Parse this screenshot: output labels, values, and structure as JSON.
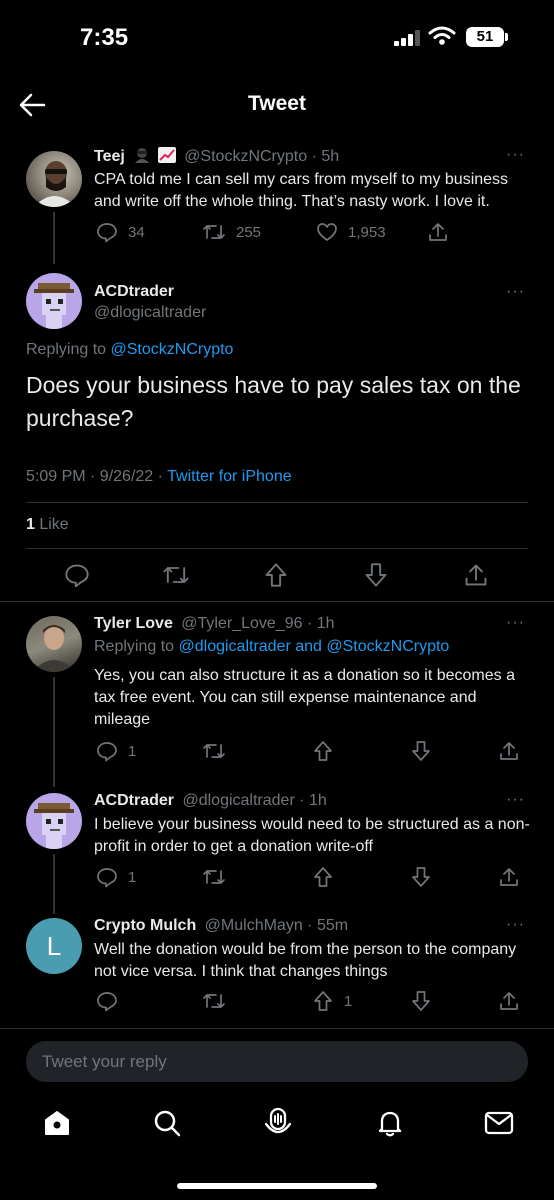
{
  "status": {
    "time": "7:35",
    "battery": "51"
  },
  "header": {
    "title": "Tweet"
  },
  "tweet1": {
    "name": "Teej",
    "handle": "@StockzNCrypto",
    "time": "· 5h",
    "text": "CPA told me I can sell my cars from myself to my business and write off the whole thing. That’s nasty work. I love it.",
    "replies": "34",
    "retweets": "255",
    "likes": "1,953"
  },
  "main": {
    "name": "ACDtrader",
    "handle": "@dlogicaltrader",
    "replying_prefix": "Replying to ",
    "replying_to": "@StockzNCrypto",
    "text": "Does your business have to pay sales tax on the purchase?",
    "timestamp": "5:09 PM · 9/26/22 · ",
    "source": "Twitter for iPhone",
    "like_count": "1",
    "like_label": " Like"
  },
  "reply1": {
    "name": "Tyler Love",
    "handle": "@Tyler_Love_96",
    "time": "· 1h",
    "replying_prefix": "Replying to ",
    "replying_to": "@dlogicaltrader and @StockzNCrypto",
    "text": "Yes, you can also structure it as a donation so it becomes a tax free event. You can still expense maintenance and mileage",
    "replies": "1"
  },
  "reply2": {
    "name": "ACDtrader",
    "handle": "@dlogicaltrader",
    "time": "· 1h",
    "text": "I believe your business would need to be structured as a non-profit in order to get a donation write-off",
    "replies": "1"
  },
  "reply3": {
    "name": "Crypto Mulch",
    "handle": "@MulchMayn",
    "time": "· 55m",
    "avatar_letter": "L",
    "text": "Well the donation would be from the person to the company not vice versa. I think that changes things",
    "upvotes": "1"
  },
  "composer": {
    "placeholder": "Tweet your reply"
  },
  "colors": {
    "accent": "#1d9bf0",
    "muted": "#71767b",
    "background": "#000000"
  }
}
